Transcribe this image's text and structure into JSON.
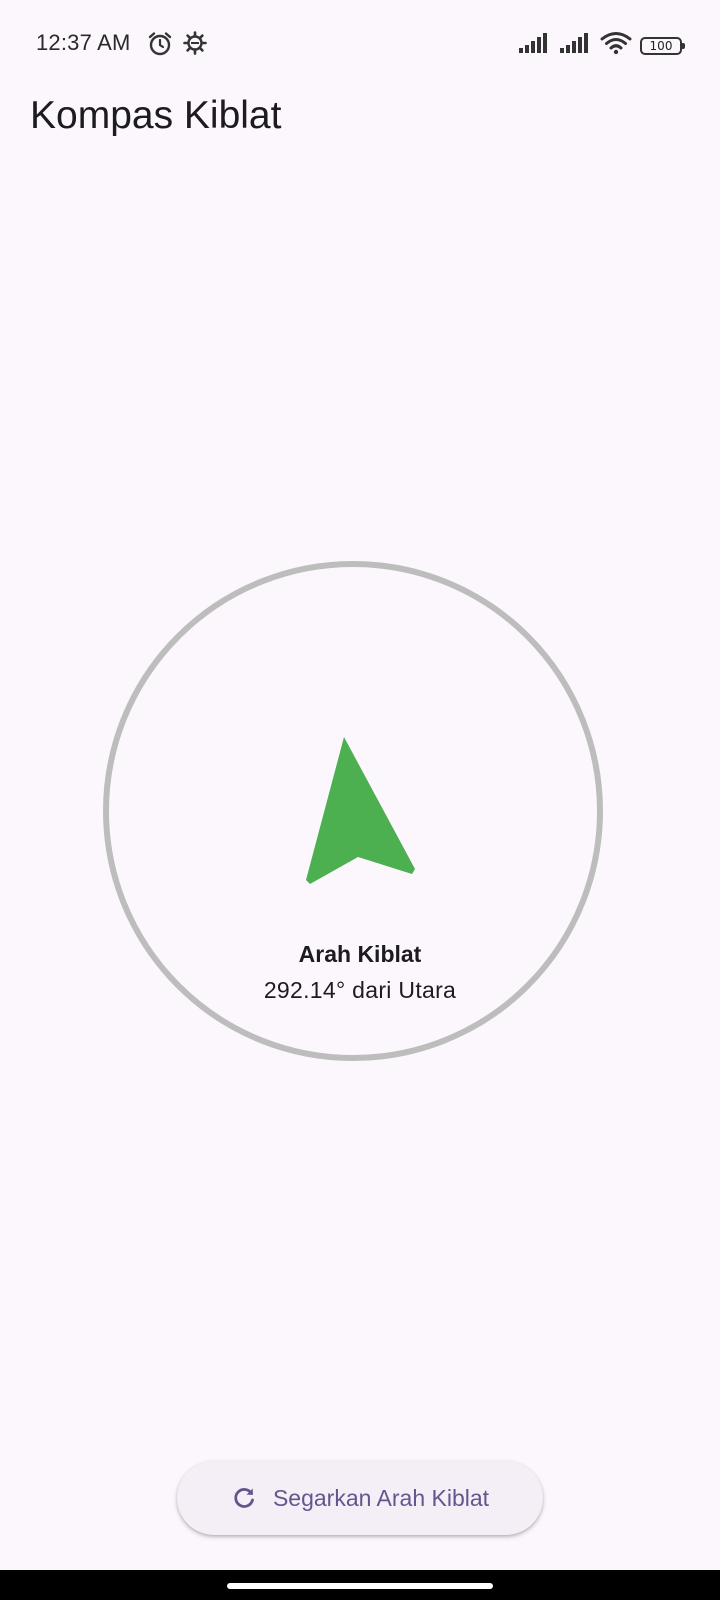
{
  "status_bar": {
    "time": "12:37 AM",
    "icons": [
      "alarm-icon",
      "settings-gear-icon",
      "signal-icon",
      "signal-icon",
      "wifi-icon",
      "battery-icon"
    ],
    "battery_level": "100"
  },
  "app_bar": {
    "title": "Kompas Kiblat"
  },
  "compass": {
    "arrow_color": "#4caf50",
    "ring_color": "#bdbdbd",
    "label": "Arah Kiblat",
    "value": "292.14° dari Utara"
  },
  "refresh_button": {
    "icon": "refresh-icon",
    "label": "Segarkan Arah Kiblat",
    "color": "#65558f"
  }
}
